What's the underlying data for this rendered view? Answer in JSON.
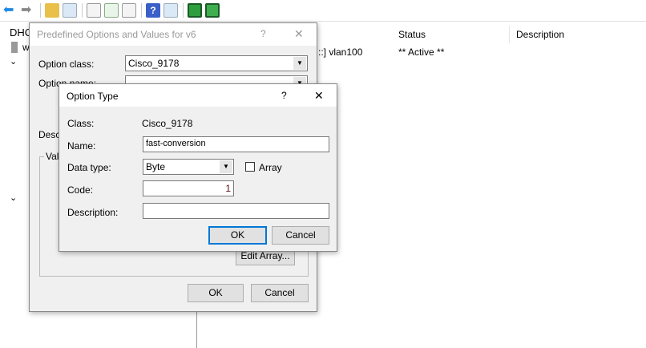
{
  "tree": {
    "root_label": "DHC",
    "server_label": "w"
  },
  "list": {
    "columns": [
      "Status",
      "Description"
    ],
    "row": {
      "name": "::] vlan100",
      "status": "** Active **"
    }
  },
  "predefined": {
    "title": "Predefined Options and Values for v6",
    "help": "?",
    "close": "✕",
    "option_class_label": "Option class:",
    "option_class_value": "Cisco_9178",
    "option_name_label": "Option name:",
    "option_name_value": "",
    "description_label": "Descr",
    "value_group_label": "Valu",
    "edit_array": "Edit Array...",
    "ok": "OK",
    "cancel": "Cancel"
  },
  "option_type": {
    "title": "Option Type",
    "help": "?",
    "close": "✕",
    "class_label": "Class:",
    "class_value": "Cisco_9178",
    "name_label": "Name:",
    "name_value": "fast-conversion",
    "data_type_label": "Data type:",
    "data_type_value": "Byte",
    "array_label": "Array",
    "array_checked": false,
    "code_label": "Code:",
    "code_value": "1",
    "description_label": "Description:",
    "description_value": "",
    "ok": "OK",
    "cancel": "Cancel"
  }
}
